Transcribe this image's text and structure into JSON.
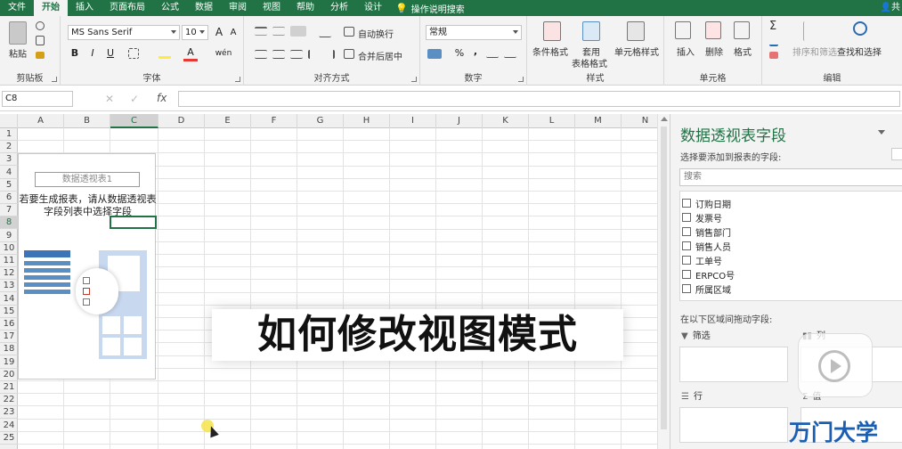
{
  "tabs": [
    {
      "label": "文件",
      "active": false
    },
    {
      "label": "开始",
      "active": true
    },
    {
      "label": "插入",
      "active": false
    },
    {
      "label": "页面布局",
      "active": false
    },
    {
      "label": "公式",
      "active": false
    },
    {
      "label": "数据",
      "active": false
    },
    {
      "label": "审阅",
      "active": false
    },
    {
      "label": "视图",
      "active": false
    },
    {
      "label": "帮助",
      "active": false
    },
    {
      "label": "分析",
      "active": false
    },
    {
      "label": "设计",
      "active": false
    }
  ],
  "tell_me": "操作说明搜索",
  "user_initial": "共",
  "ribbon": {
    "clipboard": {
      "group": "剪贴板",
      "paste": "粘贴"
    },
    "font": {
      "group": "字体",
      "font_name": "MS Sans Serif",
      "font_size": "10",
      "bold": "B",
      "italic": "I",
      "underline": "U",
      "grow": "A",
      "shrink": "A",
      "font_color": "A",
      "phonetic": "wén"
    },
    "alignment": {
      "group": "对齐方式",
      "wrap": "自动换行",
      "merge": "合并后居中"
    },
    "number": {
      "group": "数字",
      "format": "常规",
      "percent": "%",
      "comma": ","
    },
    "styles": {
      "group": "样式",
      "conditional": "条件格式",
      "table": "套用",
      "table2": "表格格式",
      "cell_styles": "单元格样式"
    },
    "cells": {
      "group": "单元格",
      "insert": "插入",
      "delete": "删除",
      "format": "格式"
    },
    "editing": {
      "group": "编辑",
      "sort": "排序和筛选",
      "find": "查找和选择"
    }
  },
  "formula_bar": {
    "name_box": "C8",
    "fx": "fx",
    "cancel": "✕",
    "enter": "✓"
  },
  "columns": [
    "A",
    "B",
    "C",
    "D",
    "E",
    "F",
    "G",
    "H",
    "I",
    "J",
    "K",
    "L",
    "M",
    "N"
  ],
  "selected_column": "C",
  "rows": [
    "1",
    "2",
    "3",
    "4",
    "5",
    "6",
    "7",
    "8",
    "9",
    "10",
    "11",
    "12",
    "13",
    "14",
    "15",
    "16",
    "17",
    "18",
    "19",
    "20",
    "21",
    "22",
    "23",
    "24",
    "25"
  ],
  "selected_row": "8",
  "pivot": {
    "title": "数据透视表1",
    "instruction_line1": "若要生成报表，请从数据透视表",
    "instruction_line2": "字段列表中选择字段"
  },
  "pane": {
    "title": "数据透视表字段",
    "subtitle": "选择要添加到报表的字段:",
    "search_placeholder": "搜索",
    "fields": [
      "订购日期",
      "发票号",
      "销售部门",
      "销售人员",
      "工单号",
      "ERPCO号",
      "所属区域"
    ],
    "drag_hint": "在以下区域间拖动字段:",
    "zones": {
      "filter": "筛选",
      "rows": "行",
      "columns": "列",
      "values": "值"
    }
  },
  "caption": "如何修改视图模式",
  "watermark": "万门大学",
  "colors": {
    "accent": "#217346",
    "ribbon_bg": "#f3f3f3",
    "caption_text": "#111111",
    "watermark": "#1a5fb4"
  }
}
